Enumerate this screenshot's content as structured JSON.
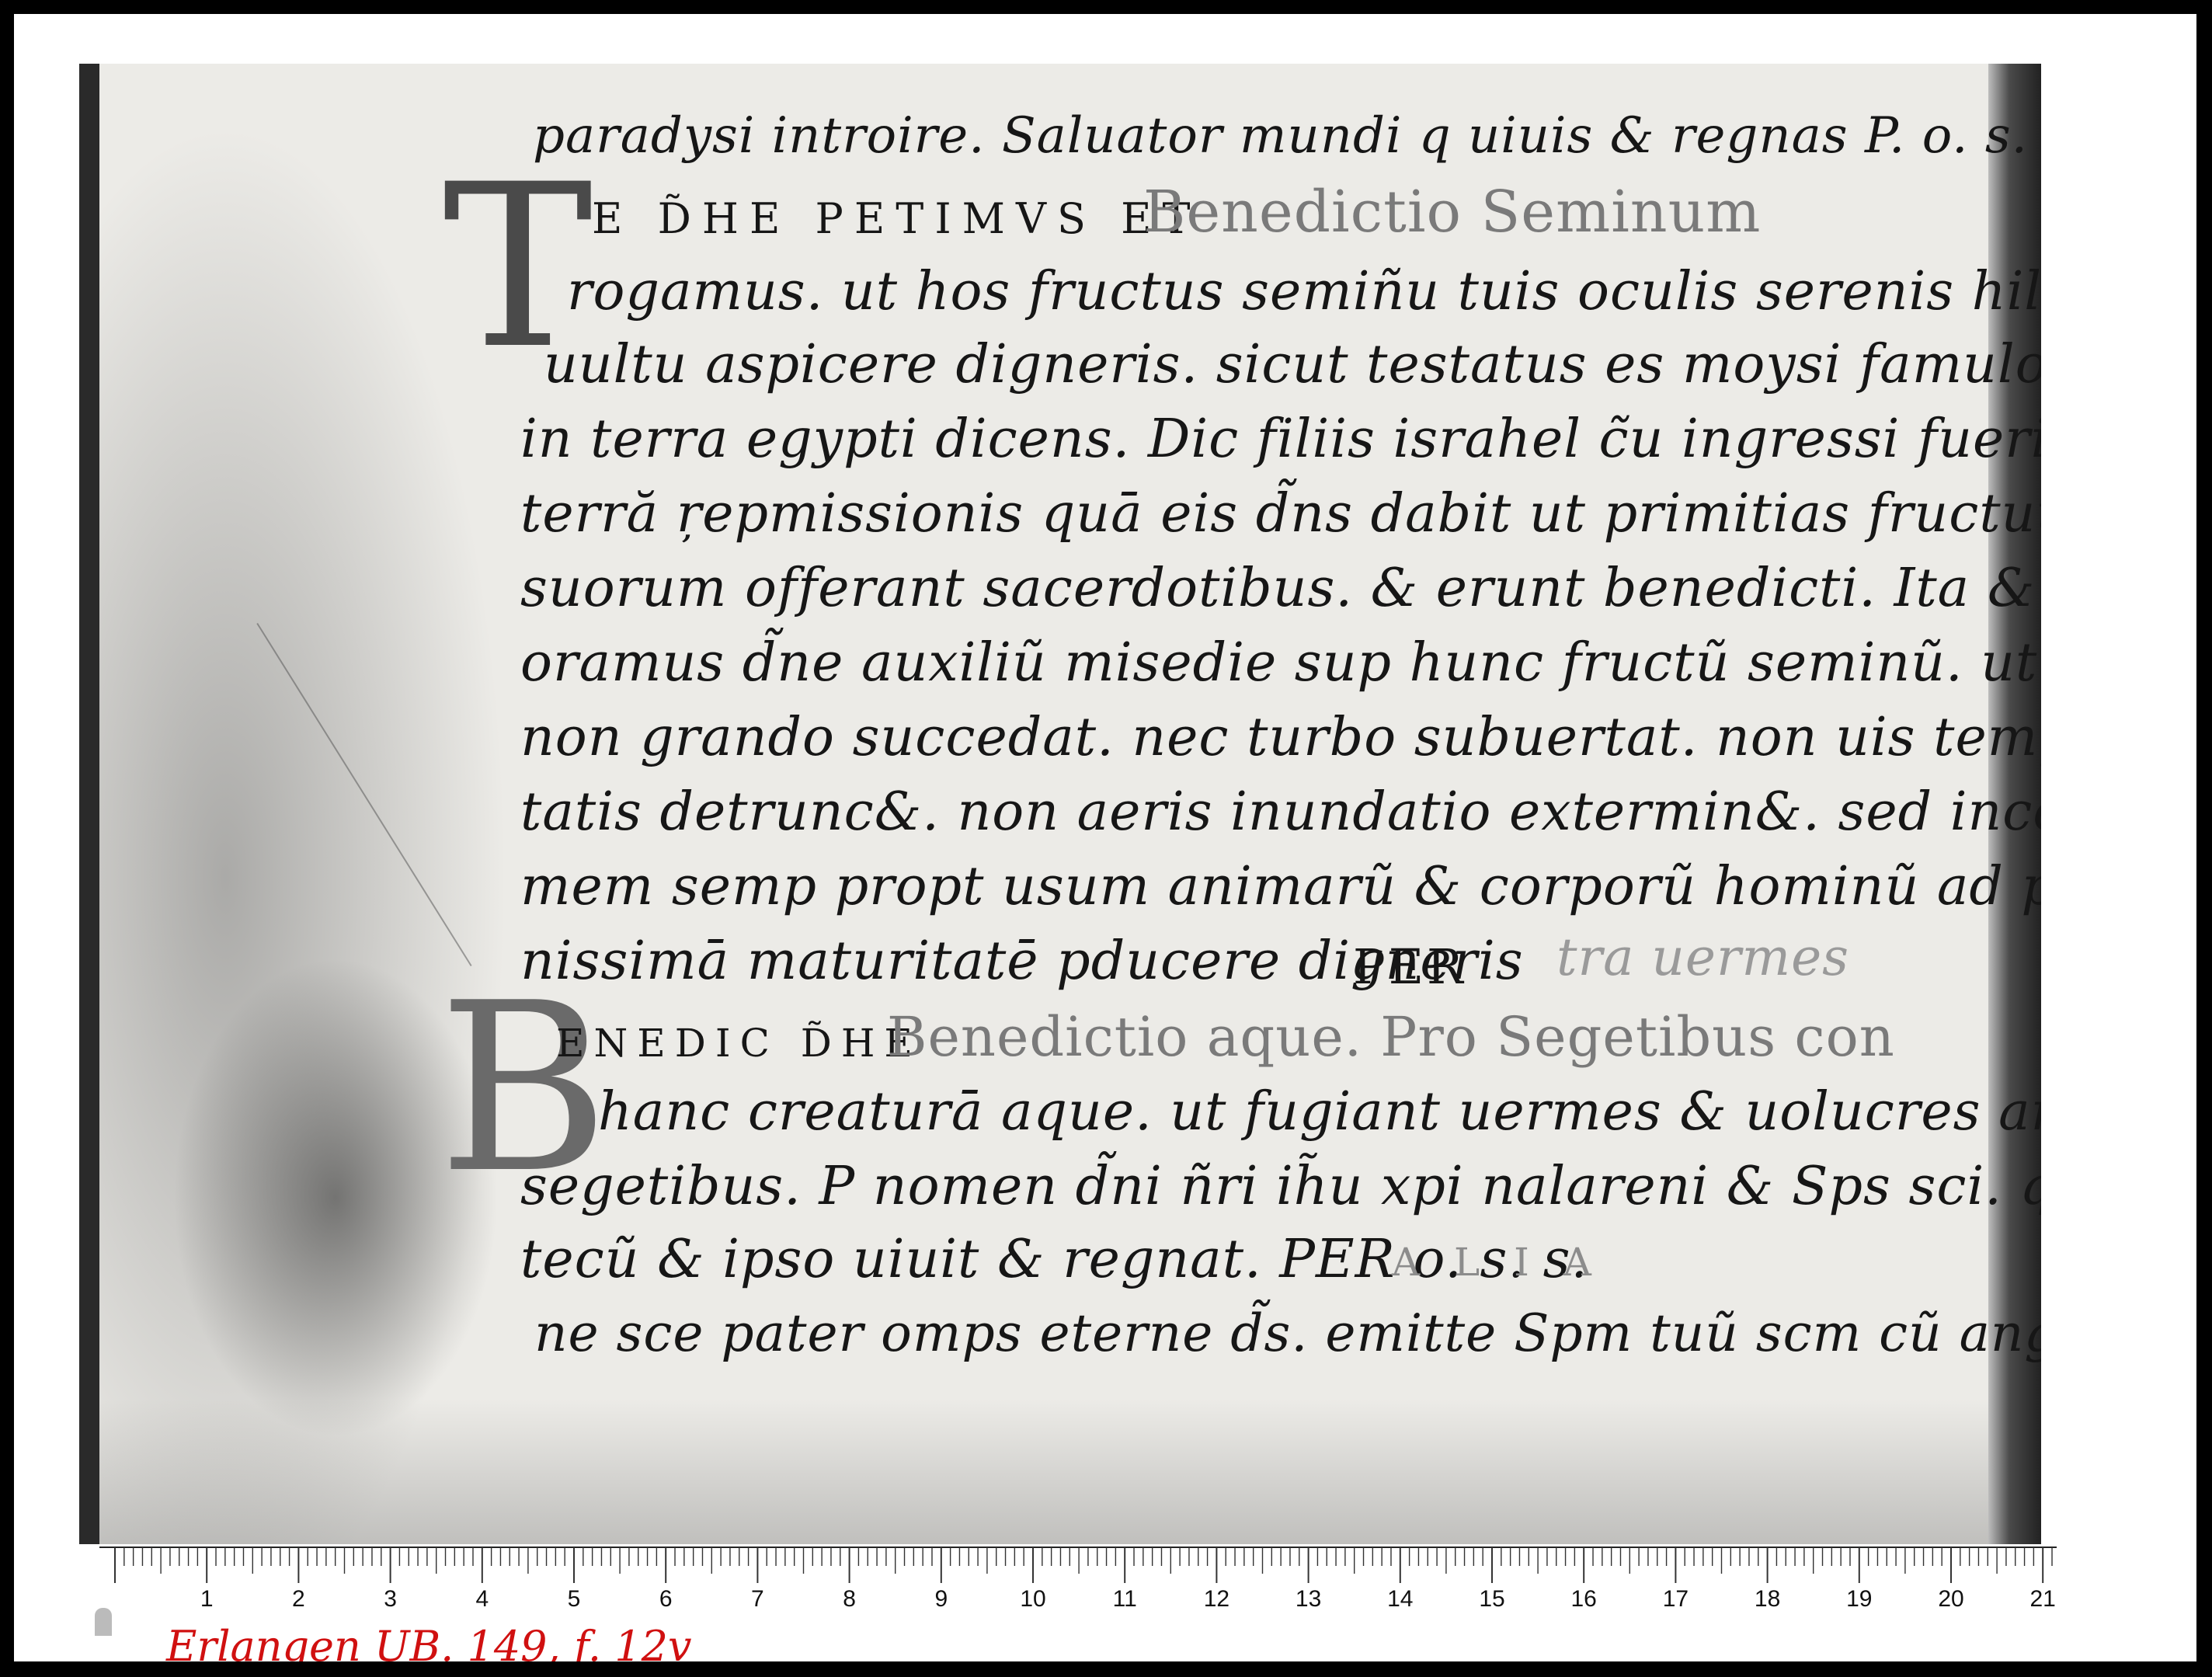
{
  "manuscript": {
    "lines": [
      "paradysi introire. Saluator mundi q uiuis & regnas P. o. s. s. am.",
      "rogamus. ut hos fructus semiñu tuis oculis serenis hilariq;",
      "uultu aspicere digneris. sicut testatus es moysi famulo tuo",
      "in terra egypti dicens. Dic filiis israhel c̃u ingressi fuerint",
      "terră ŗepmissionis quā eis d̃ns dabit ut primitias fructuũ",
      "suorum offerant sacerdotibus. & erunt benedicti. Ita & nos",
      "oramus d̃ne auxiliũ misedie sup hunc fructũ seminũ. ut",
      "non grando succedat. nec turbo subuertat. non uis tempes",
      "tatis detrunc&. non aeris inundatio extermin&. sed incolo",
      "mem semp propt usum animarũ & corporũ hominũ ad ple",
      "nissimā maturitatē pducere digneris"
    ],
    "rubric_heading_1": {
      "initial": "T",
      "caps": "E D̃HE PETIMVS  ET",
      "title": "Benedictio Seminum"
    },
    "rubric_line_12_tail": "PER",
    "rubric_line_12_faded": "tra uermes",
    "rubric_heading_2": {
      "initial": "B",
      "caps": "ENEDIC D̃HE",
      "title": "Benedictio aque. Pro Segetibus con"
    },
    "lines_2": [
      "hanc creaturā aque. ut fugiant uermes & uolucres añris",
      "segetibus. P nomen d̃ni ñri ih̃u xpi nalareni & Sps sci. qui",
      "tecũ & ipso uiuit & regnat. PER o. s. s."
    ],
    "alia_label": "A L I A",
    "last_line": "ne sce pater omps eterne d̃s. emitte Spm tuũ scm cũ ange-"
  },
  "ruler": {
    "numbers": [
      "1",
      "2",
      "3",
      "4",
      "5",
      "6",
      "7",
      "8",
      "9",
      "10",
      "11",
      "12",
      "13",
      "14",
      "15",
      "16",
      "17",
      "18",
      "19",
      "20",
      "21"
    ]
  },
  "shelfmark": "Erlangen UB.   149, f. 12v"
}
